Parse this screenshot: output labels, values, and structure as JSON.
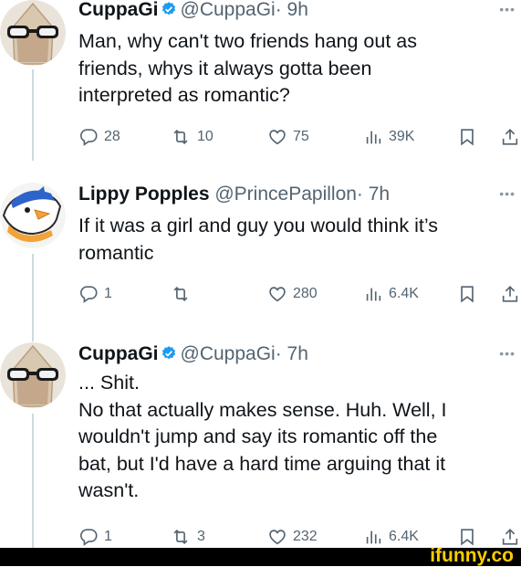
{
  "tweets": [
    {
      "name": "CuppaGi",
      "handle": "@CuppaGi",
      "time": "· 9h",
      "verified": true,
      "lines": [
        "Man, why can't two friends hang out as",
        "friends, whys it always gotta been",
        "interpreted as romantic?"
      ],
      "replies": "28",
      "retweets": "10",
      "likes": "75",
      "views": "39K"
    },
    {
      "name": "Lippy Popples",
      "handle": "@PrincePapillon",
      "time": "· 7h",
      "verified": false,
      "lines": [
        "If it was a girl and guy you would think it’s",
        "romantic"
      ],
      "replies": "1",
      "retweets": "",
      "likes": "280",
      "views": "6.4K"
    },
    {
      "name": "CuppaGi",
      "handle": "@CuppaGi",
      "time": "· 7h",
      "verified": true,
      "lines": [
        "... Shit.",
        "No that actually makes sense. Huh. Well, I",
        "wouldn't jump and say its romantic off the",
        "bat, but I'd have a hard time arguing that it",
        "wasn't."
      ],
      "replies": "1",
      "retweets": "3",
      "likes": "232",
      "views": "6.4K"
    }
  ],
  "watermark": "ifunny.co",
  "icons": [
    "reply-icon",
    "retweet-icon",
    "like-icon",
    "views-icon",
    "bookmark-icon",
    "share-icon",
    "verified-icon",
    "more-icon"
  ],
  "colors": {
    "text": "#0f1419",
    "muted": "#536471",
    "verified": "#1d9bf0",
    "watermark": "#ffcc00"
  }
}
